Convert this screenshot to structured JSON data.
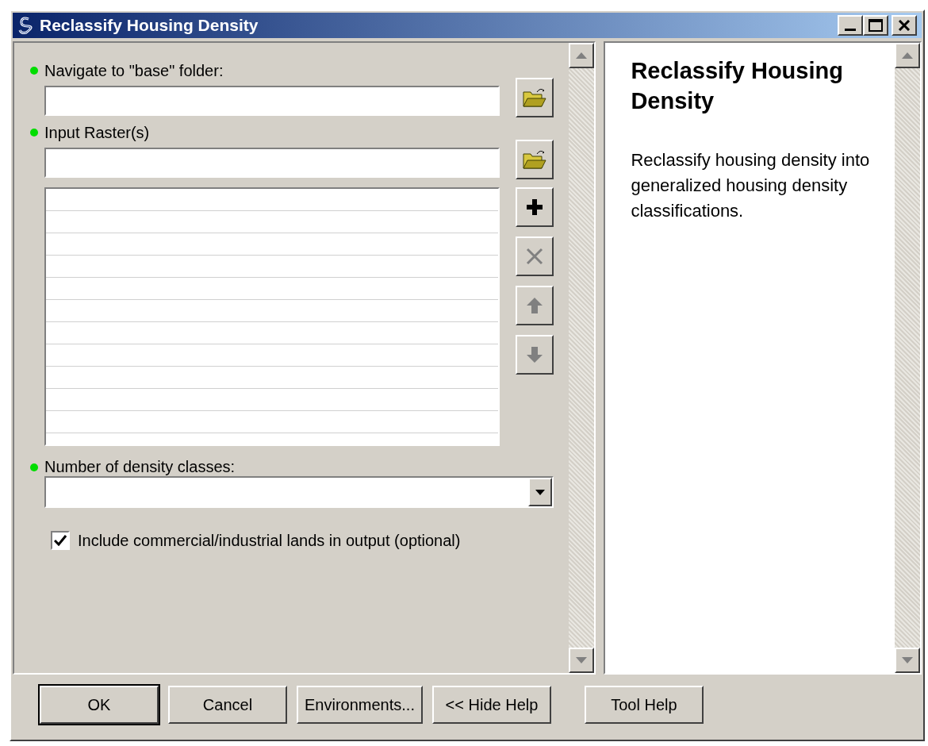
{
  "window": {
    "title": "Reclassify Housing Density"
  },
  "parameters": [
    {
      "kind": "path",
      "label": "Navigate to \"base\" folder:",
      "required": true
    },
    {
      "kind": "path",
      "label": "Input Raster(s)",
      "required": true
    },
    {
      "kind": "list",
      "buttons": [
        {
          "kind": "add",
          "disabled": false
        },
        {
          "kind": "remove",
          "disabled": true
        },
        {
          "kind": "up",
          "disabled": true
        },
        {
          "kind": "down",
          "disabled": true
        }
      ]
    },
    {
      "kind": "dropdown",
      "label": "Number of density classes:",
      "required": true
    },
    {
      "kind": "checkbox",
      "label": "Include commercial/industrial lands in output (optional)",
      "checked": true
    }
  ],
  "help": {
    "title": "Reclassify Housing Density",
    "body": "Reclassify housing density into generalized housing density classifications."
  },
  "footer": {
    "buttons": [
      {
        "label": "OK",
        "default": true
      },
      {
        "label": "Cancel",
        "default": false
      },
      {
        "label": "Environments...",
        "default": false
      },
      {
        "label": "<< Hide Help",
        "default": false
      }
    ],
    "help_button": "Tool Help"
  }
}
